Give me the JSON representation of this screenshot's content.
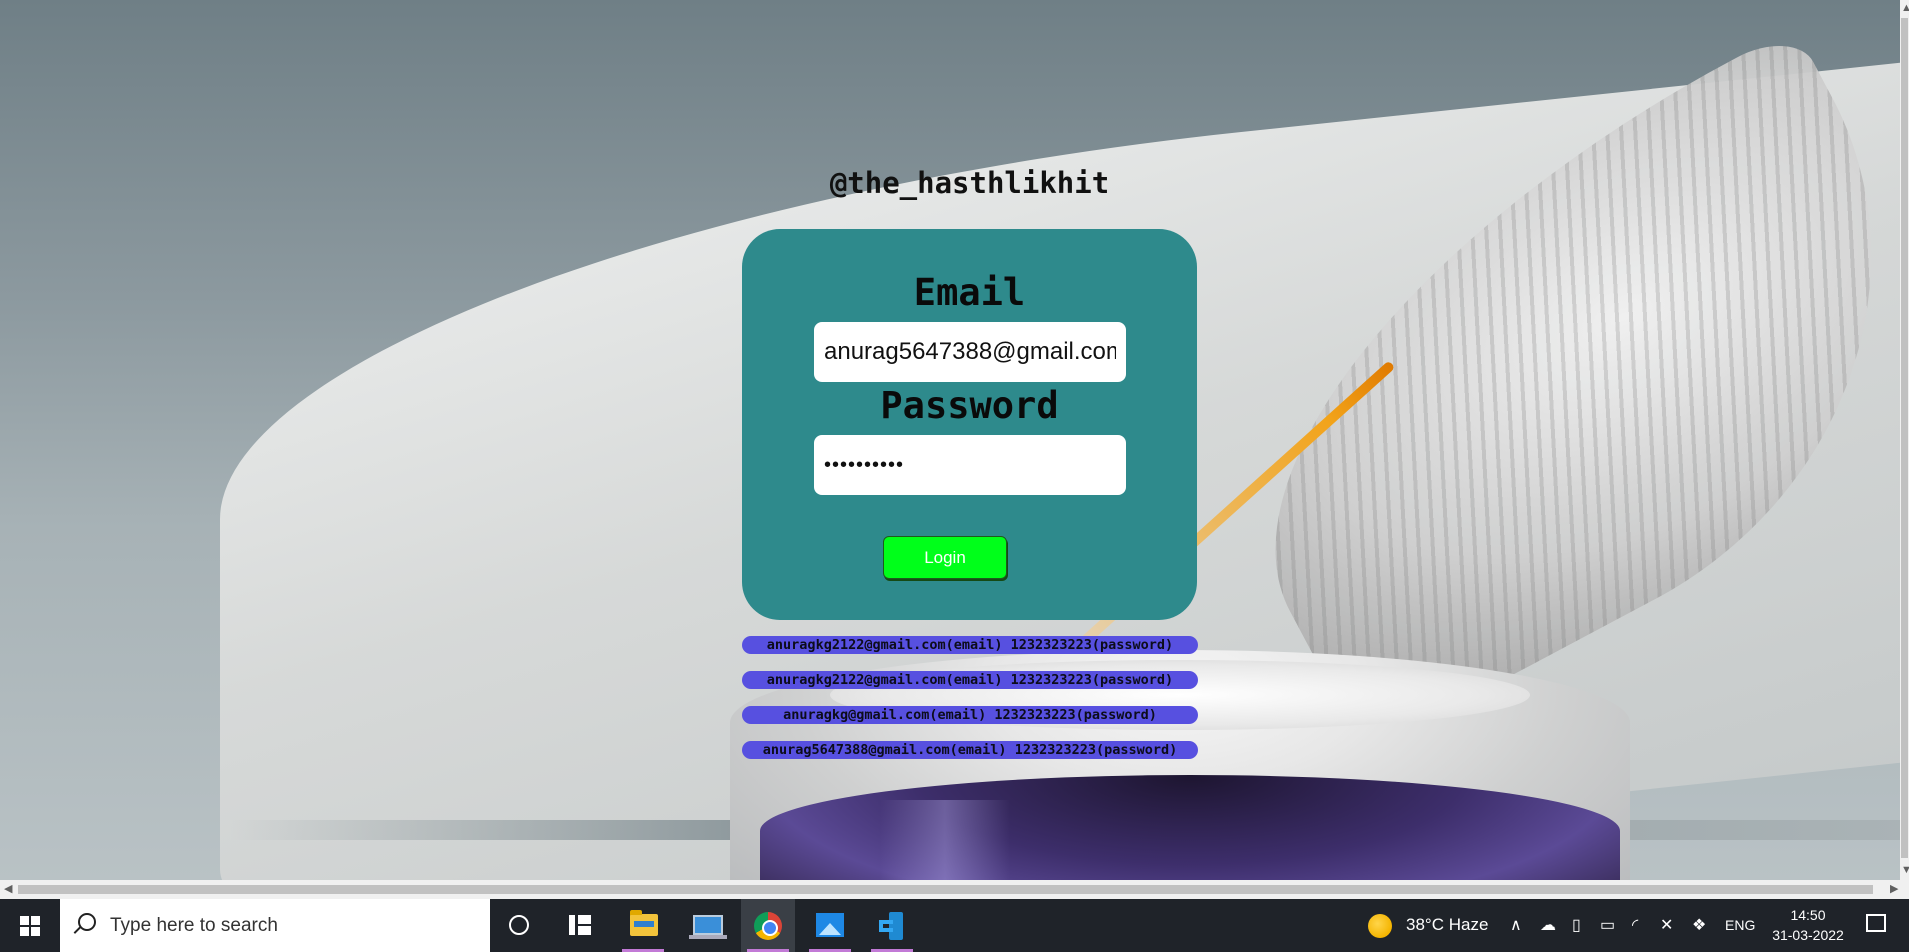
{
  "page": {
    "handle": "@the_hasthlikhit",
    "form": {
      "email_label": "Email",
      "email_value": "anurag5647388@gmail.com",
      "password_label": "Password",
      "password_value": "1232323223",
      "login_label": "Login"
    },
    "credentials": [
      "anuragkg2122@gmail.com(email) 1232323223(password)",
      "anuragkg2122@gmail.com(email) 1232323223(password)",
      "anuragkg@gmail.com(email) 1232323223(password)",
      "anurag5647388@gmail.com(email) 1232323223(password)"
    ],
    "colors": {
      "card": "#2e8a8c",
      "login_button": "#00ff1a",
      "credential_pill": "#5750e0"
    }
  },
  "taskbar": {
    "search_placeholder": "Type here to search",
    "apps": [
      "cortana-icon",
      "task-view-icon",
      "file-explorer-icon",
      "laptop-app-icon",
      "chrome-icon",
      "photos-icon",
      "vscode-icon"
    ],
    "weather": "38°C  Haze",
    "language": "ENG",
    "time": "14:50",
    "date": "31-03-2022"
  }
}
